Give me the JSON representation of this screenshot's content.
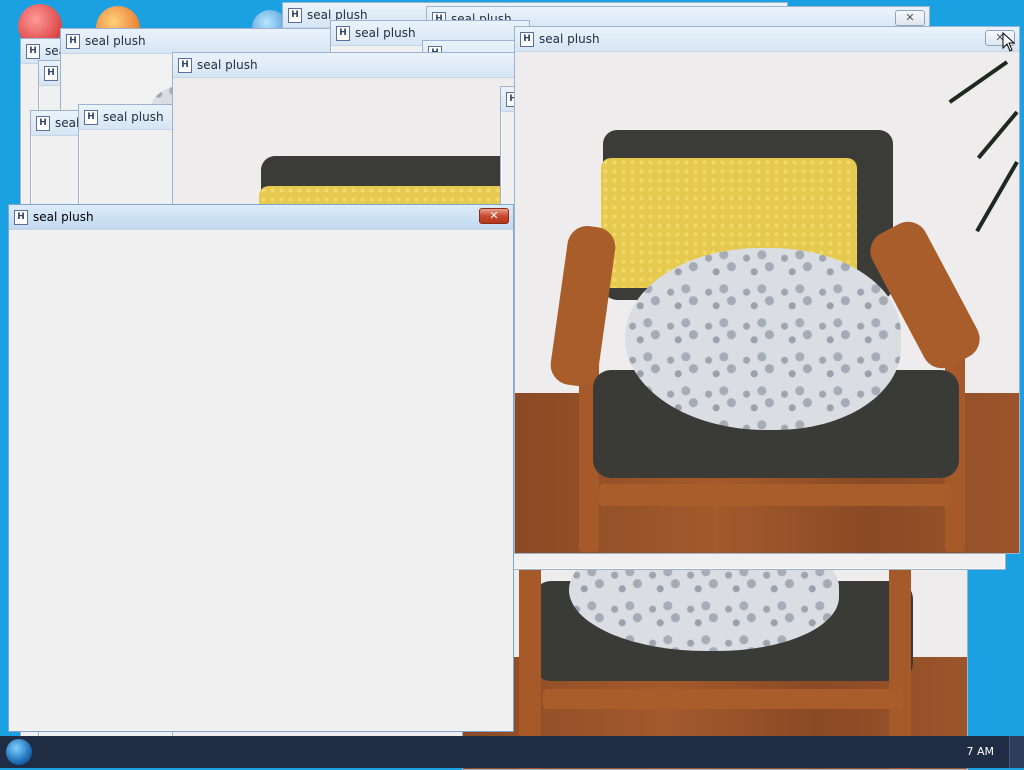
{
  "windows": {
    "title": "seal plush",
    "app_icon_letter": "H",
    "close_glyph": "✕"
  },
  "taskbar": {
    "clock": "7 AM"
  }
}
